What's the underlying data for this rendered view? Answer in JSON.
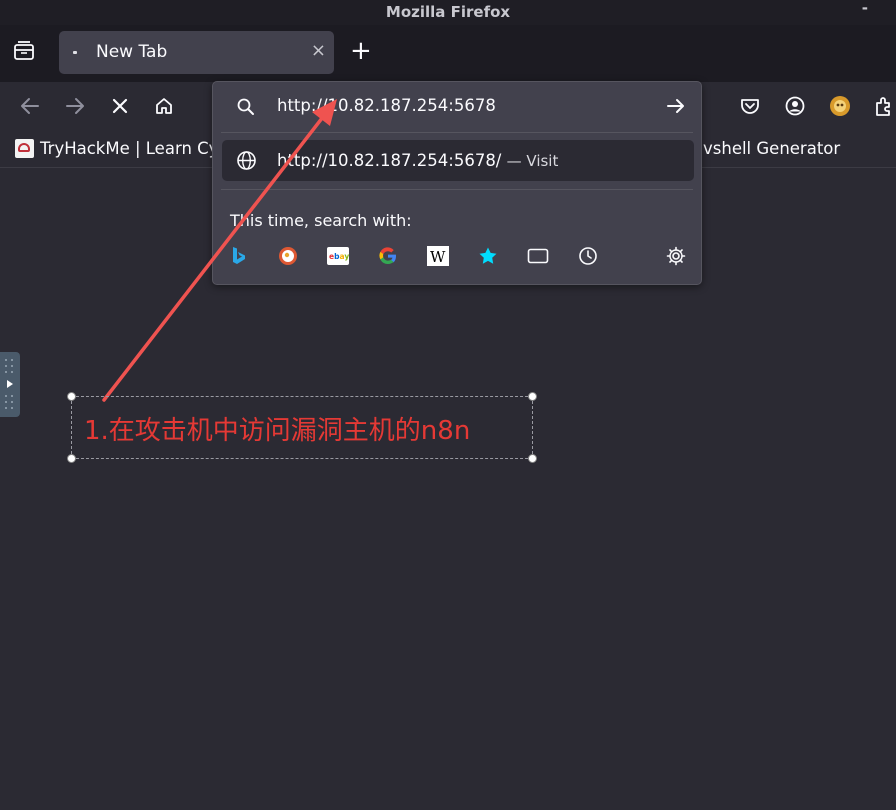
{
  "window": {
    "title": "Mozilla Firefox",
    "minimize_symbol": "-"
  },
  "tabs": [
    {
      "label": "New Tab",
      "close_symbol": "×"
    }
  ],
  "new_tab_symbol": "+",
  "toolbar": {
    "icons": [
      "back-arrow-icon",
      "forward-arrow-icon",
      "stop-icon",
      "home-icon",
      "pocket-icon",
      "account-icon",
      "extension-avatar-icon",
      "extensions-icon"
    ]
  },
  "bookmarks": [
    {
      "label": "TryHackMe | Learn Cy",
      "icon": "tryhackme-favicon"
    },
    {
      "label": "vshell Generator"
    }
  ],
  "urlbar": {
    "value": "http://10.82.187.254:5678",
    "suggestion_url": "http://10.82.187.254:5678/",
    "suggestion_action": "— Visit",
    "search_with_label": "This time, search with:",
    "engines": [
      "bing-icon",
      "duckduckgo-icon",
      "ebay-icon",
      "google-icon",
      "wikipedia-icon",
      "bookmarks-star-icon",
      "tabs-icon",
      "history-icon"
    ]
  },
  "annotation": {
    "text": "1.在攻击机中访问漏洞主机的n8n",
    "color": "#e53935"
  },
  "colors": {
    "background": "#2b2a33",
    "tab_active": "#42414d",
    "accent_red": "#e53935"
  }
}
